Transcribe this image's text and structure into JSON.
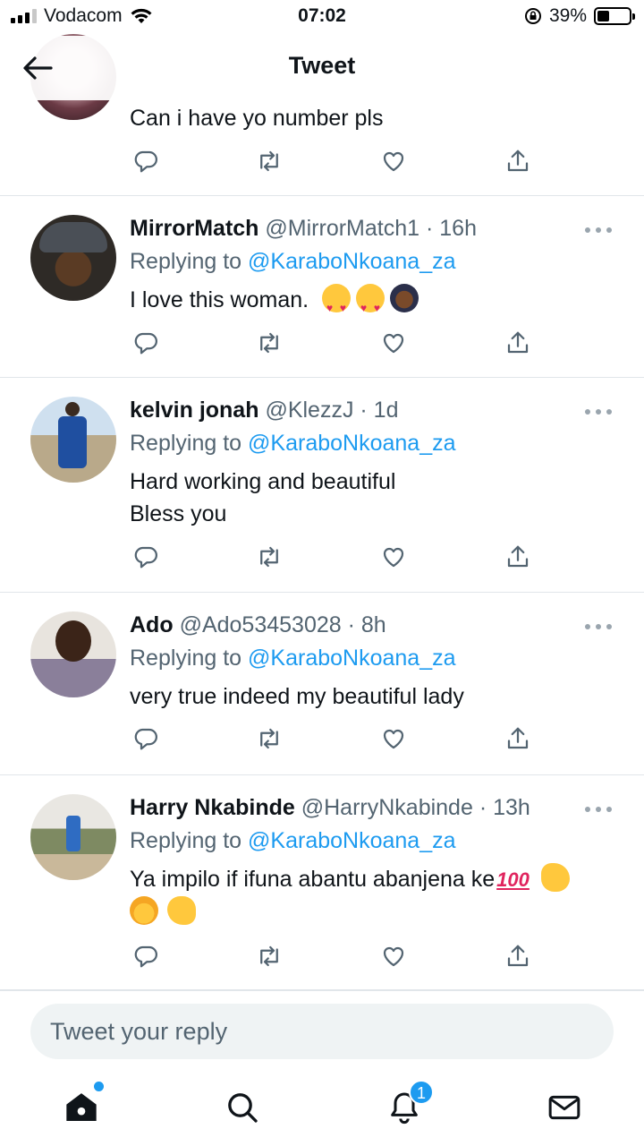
{
  "status_bar": {
    "carrier": "Vodacom",
    "time": "07:02",
    "battery": "39%",
    "battery_level": 0.39
  },
  "header": {
    "title": "Tweet"
  },
  "tweets": [
    {
      "name": "",
      "handle": "",
      "time": "",
      "replying_prefix": "",
      "replying_to": "",
      "text": "Can i have yo number pls",
      "emojis": []
    },
    {
      "name": "MirrorMatch",
      "handle": "@MirrorMatch1",
      "time": "16h",
      "replying_prefix": "Replying to ",
      "replying_to": "@KaraboNkoana_za",
      "text": "I love this woman.",
      "emojis": [
        "heart-eyes-emoji",
        "heart-eyes-emoji",
        "person-facepalming-emoji"
      ]
    },
    {
      "name": "kelvin jonah",
      "handle": "@KlezzJ",
      "time": "1d",
      "replying_prefix": "Replying to ",
      "replying_to": "@KaraboNkoana_za",
      "text": "Hard working and beautiful",
      "text2": "Bless you",
      "emojis": []
    },
    {
      "name": "Ado",
      "handle": "@Ado53453028",
      "time": "8h",
      "replying_prefix": "Replying to ",
      "replying_to": "@KaraboNkoana_za",
      "text": "very true indeed my beautiful lady",
      "emojis": []
    },
    {
      "name": "Harry Nkabinde",
      "handle": "@HarryNkabinde",
      "time": "13h",
      "replying_prefix": "Replying to ",
      "replying_to": "@KaraboNkoana_za",
      "text": "Ya impilo if ifuna abantu abanjena ke",
      "emojis": [
        "hundred-points-emoji",
        "clapping-hands-emoji",
        "crown-person-emoji",
        "ok-hand-emoji"
      ]
    }
  ],
  "reply_bar": {
    "placeholder": "Tweet your reply"
  },
  "tab_bar": {
    "notifications_count": "1",
    "items": [
      "home-icon",
      "search-icon",
      "bell-icon",
      "mail-icon"
    ]
  },
  "colors": {
    "accent": "#1d9bf0",
    "text": "#0f1419",
    "secondary": "#536471",
    "divider": "#e1e6ea"
  }
}
